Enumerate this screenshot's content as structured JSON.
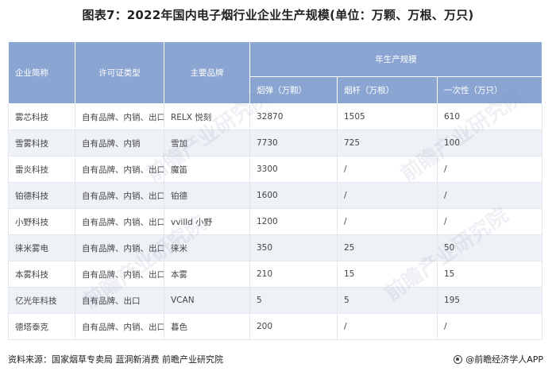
{
  "title": "图表7：2022年国内电子烟行业企业生产规模(单位：万颗、万根、万只)",
  "table": {
    "headers": {
      "company": "企业简称",
      "license": "许可证类型",
      "brand": "主要品牌",
      "scale_group": "年生产规模",
      "pods": "烟弹（万颗）",
      "rods": "烟杆（万根）",
      "disposable": "一次性（万只）"
    },
    "rows": [
      {
        "company": "雾芯科技",
        "license": "自有品牌、内销、出口",
        "brand": "RELX 悦刻",
        "pods": "32870",
        "rods": "1505",
        "disposable": "610"
      },
      {
        "company": "雪雾科技",
        "license": "自有品牌、内销",
        "brand": "雪加",
        "pods": "7730",
        "rods": "725",
        "disposable": "100"
      },
      {
        "company": "雷炎科技",
        "license": "自有品牌、内销、出口",
        "brand": "魔笛",
        "pods": "3300",
        "rods": "/",
        "disposable": "/"
      },
      {
        "company": "铂德科技",
        "license": "自有品牌、内销、出口",
        "brand": "铂德",
        "pods": "1600",
        "rods": "/",
        "disposable": "/"
      },
      {
        "company": "小野科技",
        "license": "自有品牌、内销、出口",
        "brand": "vvilld 小野",
        "pods": "1200",
        "rods": "/",
        "disposable": "/"
      },
      {
        "company": "徕米雾电",
        "license": "自有品牌、内销、出口",
        "brand": "徕米",
        "pods": "350",
        "rods": "25",
        "disposable": "50"
      },
      {
        "company": "本雾科技",
        "license": "自有品牌、内销、出口",
        "brand": "本雾",
        "pods": "210",
        "rods": "15",
        "disposable": "15"
      },
      {
        "company": "亿光年科技",
        "license": "自有品牌、出口",
        "brand": "VCAN",
        "pods": "5",
        "rods": "5",
        "disposable": "195"
      },
      {
        "company": "德塔泰克",
        "license": "自有品牌、内销、出口",
        "brand": "暮色",
        "pods": "200",
        "rods": "/",
        "disposable": "/"
      }
    ]
  },
  "watermark": "前瞻产业研究院",
  "footer": {
    "source": "资料来源：国家烟草专卖局 蓝洞新消费 前瞻产业研究院",
    "brand_icon": "qianzhan-logo-icon",
    "brand": "@前瞻经济学人APP"
  }
}
